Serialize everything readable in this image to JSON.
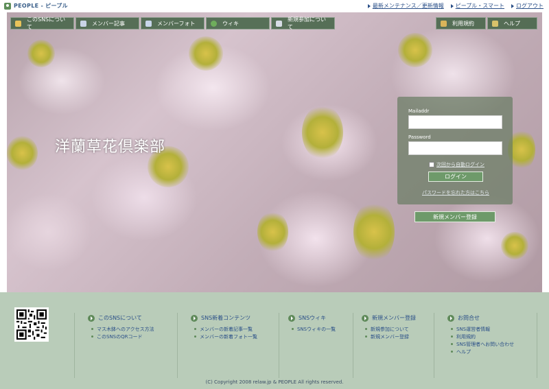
{
  "brand": {
    "name": "PEOPLE - ピープル"
  },
  "top_links": [
    {
      "label": "最新メンテナンス／更新情報"
    },
    {
      "label": "ピープル・スマート"
    },
    {
      "label": "ログアウト"
    }
  ],
  "nav": {
    "left": [
      {
        "label": "このSNSについて",
        "icon": "info-icon",
        "color": "#e9c35a"
      },
      {
        "label": "メンバー記事",
        "icon": "article-icon",
        "color": "#c9d3e6"
      },
      {
        "label": "メンバーフォト",
        "icon": "photo-icon",
        "color": "#c8d6ea"
      },
      {
        "label": "ウィキ",
        "icon": "globe-icon",
        "color": "#6fae5c"
      },
      {
        "label": "新規参加について",
        "icon": "people-icon",
        "color": "#d8dde6"
      }
    ],
    "right": [
      {
        "label": "利用規約",
        "icon": "terms-icon",
        "color": "#d9b55a"
      },
      {
        "label": "ヘルプ",
        "icon": "help-icon",
        "color": "#d8c26a"
      }
    ]
  },
  "hero": {
    "title": "洋蘭草花倶楽部"
  },
  "login": {
    "mail_label": "Mailaddr",
    "password_label": "Password",
    "remember_label": "次回から自動ログイン",
    "login_button": "ログイン",
    "forgot_link": "パスワードを忘れた方はこちら",
    "register_button": "新規メンバー登録"
  },
  "footer": {
    "columns": [
      {
        "heading": "このSNSについて",
        "links": [
          "マス木鉢へのアクセス方法",
          "このSNSのQRコード"
        ]
      },
      {
        "heading": "SNS新着コンテンツ",
        "links": [
          "メンバーの新着記事一覧",
          "メンバーの新着フォト一覧"
        ]
      },
      {
        "heading": "SNSウィキ",
        "links": [
          "SNSウィキの一覧"
        ]
      },
      {
        "heading": "新規メンバー登録",
        "links": [
          "新規参加について",
          "新規メンバー登録"
        ]
      },
      {
        "heading": "お問合せ",
        "links": [
          "SNS運営者情報",
          "利用規約",
          "SNS管理者へお問い合わせ",
          "ヘルプ"
        ]
      }
    ],
    "copyright": "(C) Copyright 2008 relaw.jp & PEOPLE All rights reserved."
  },
  "colors": {
    "nav_bg": "#46644a",
    "footer_bg": "#b9ccb9",
    "link": "#2a4f88",
    "button": "#6e9a6a"
  }
}
